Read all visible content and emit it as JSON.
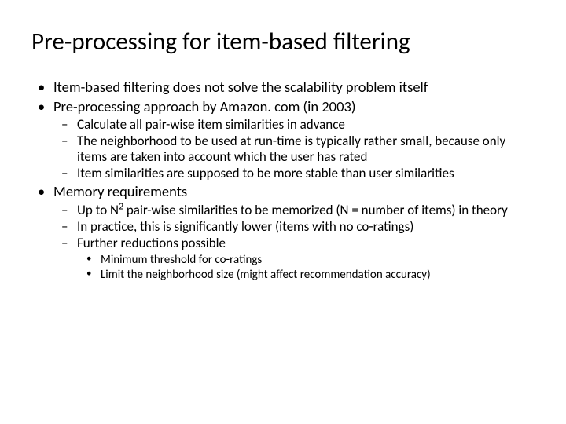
{
  "title": "Pre-processing for item-based filtering",
  "b1": "Item-based filtering does not solve the scalability problem itself",
  "b2": "Pre-processing approach by Amazon. com (in 2003)",
  "b2s1": "Calculate all pair-wise item similarities in advance",
  "b2s2": "The neighborhood to be used at run-time is typically rather small, because only items are taken into account which the user has rated",
  "b2s3": "Item similarities are supposed to be more stable than user similarities",
  "b3": "Memory requirements",
  "b3s1a": "Up to N",
  "b3s1b": "2",
  "b3s1c": " pair-wise similarities to be memorized (N = number of items) in theory",
  "b3s2": "In practice, this is significantly lower (items with no co-ratings)",
  "b3s3": "Further reductions possible",
  "b3s3a": "Minimum threshold for co-ratings",
  "b3s3b": "Limit the neighborhood size (might affect recommendation accuracy)"
}
